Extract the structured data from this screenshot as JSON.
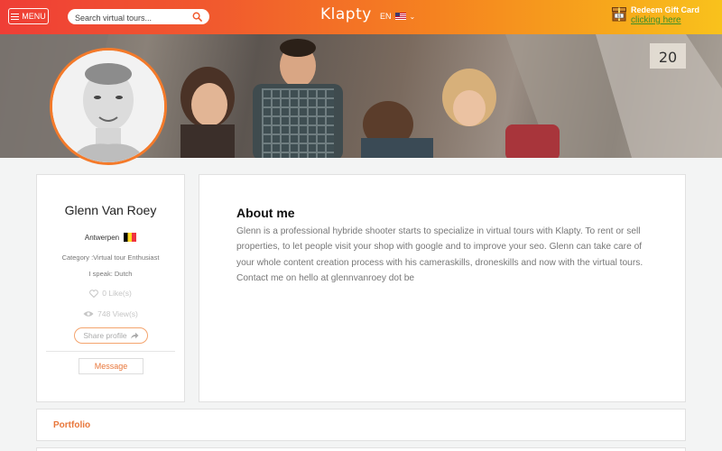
{
  "header": {
    "menu_label": "MENU",
    "search_placeholder": "Search virtual tours...",
    "logo": "Klapty",
    "language": "EN",
    "gift_title": "Redeem Gift Card",
    "gift_link": "clicking here"
  },
  "profile": {
    "name": "Glenn Van Roey",
    "city": "Antwerpen",
    "category": "Category :Virtual tour Enthusiast",
    "speaks": "I speak: Dutch",
    "likes": "0 Like(s)",
    "views": "748 View(s)",
    "share_label": "Share profile",
    "message_label": "Message"
  },
  "about": {
    "heading": "About me",
    "text": "Glenn is a professional hybride shooter starts to specialize in virtual tours with Klapty. To rent or sell properties, to let people visit your shop with google and to improve your seo. Glenn can take care of your whole content creation process with his cameraskills, droneskills and now with the virtual tours. Contact me on hello at glennvanroey dot be"
  },
  "portfolio": {
    "label": "Portfolio"
  },
  "colors": {
    "accent": "#e8763a",
    "header_start": "#ef3e36",
    "header_end": "#f9c21c",
    "link_green": "#3a8f2a"
  },
  "icons": [
    "menu-icon",
    "search-icon",
    "us-flag-icon",
    "chevron-down-icon",
    "gift-icon",
    "belgium-flag-icon",
    "heart-icon",
    "eye-icon",
    "share-icon"
  ]
}
